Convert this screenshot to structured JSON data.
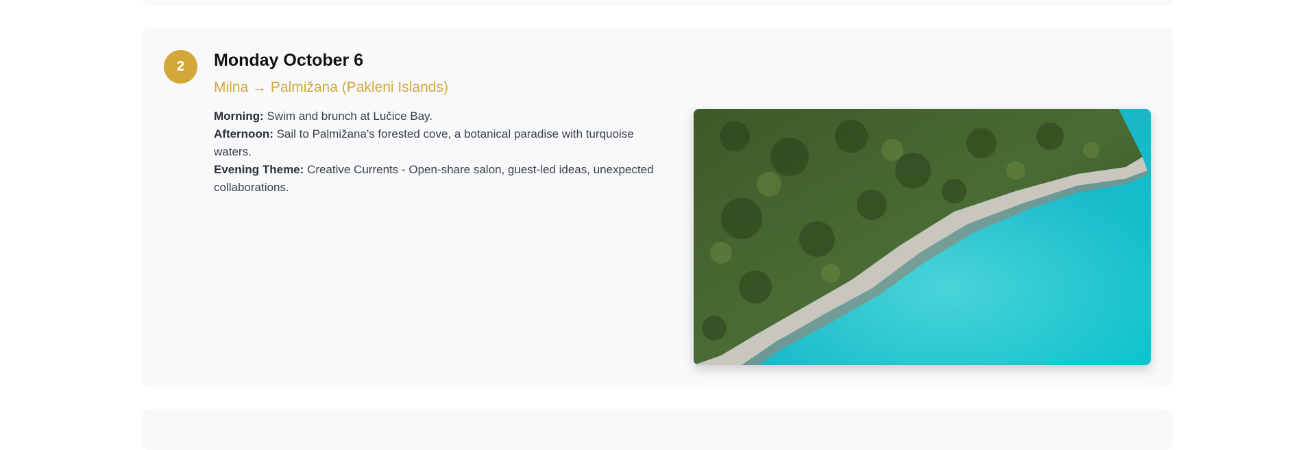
{
  "itinerary_day": {
    "number": "2",
    "title": "Monday October 6",
    "route": "Milna → Palmižana (Pakleni Islands)",
    "details": [
      {
        "label": "Morning:",
        "text": " Swim and brunch at Lučice Bay."
      },
      {
        "label": "Afternoon:",
        "text": " Sail to Palmižana's forested cove, a botanical paradise with turquoise waters."
      },
      {
        "label": "Evening Theme:",
        "text": " Creative Currents - Open-share salon, guest-led ideas, unexpected collaborations."
      }
    ],
    "photo": {
      "subject": "aerial coastline with forest and turquoise water"
    }
  },
  "colors": {
    "accent": "#d4a838",
    "route_text": "#d4a838",
    "card_bg": "#f8f9fb"
  }
}
